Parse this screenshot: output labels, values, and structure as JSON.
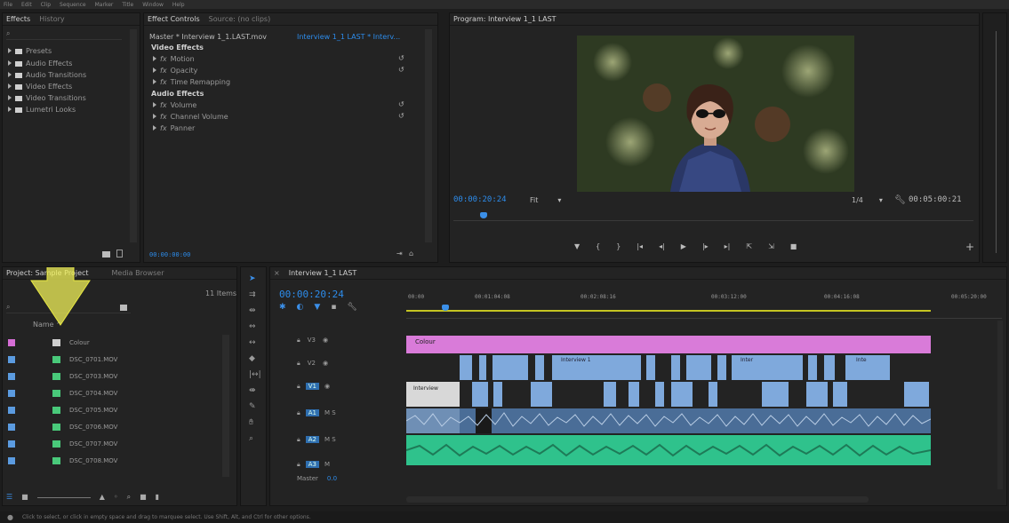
{
  "menubar": [
    "File",
    "Edit",
    "Clip",
    "Sequence",
    "Marker",
    "Title",
    "Window",
    "Help"
  ],
  "effects_panel": {
    "tabs": [
      "Effects",
      "History"
    ],
    "items": [
      "Presets",
      "Audio Effects",
      "Audio Transitions",
      "Video Effects",
      "Video Transitions",
      "Lumetri Looks"
    ]
  },
  "effect_controls": {
    "tabs": [
      "Effect Controls",
      "Source: (no clips)"
    ],
    "master_label": "Master * Interview 1_1.LAST.mov",
    "sequence_label": "Interview 1_1 LAST * Interv...",
    "video_header": "Video Effects",
    "video_items": [
      "Motion",
      "Opacity",
      "Time Remapping"
    ],
    "audio_header": "Audio Effects",
    "audio_items": [
      "Volume",
      "Channel Volume",
      "Panner"
    ],
    "timecode": "00:00:00:00"
  },
  "program_monitor": {
    "title": "Program: Interview 1_1 LAST",
    "timecode": "00:00:20:24",
    "fit_label": "Fit",
    "quality_label": "1/4",
    "duration": "00:05:00:21"
  },
  "project_panel": {
    "tabs": [
      "Project: Sample Project",
      "Media Browser"
    ],
    "items_count": "11 Items",
    "name_header": "Name",
    "items": [
      {
        "name": "Colour",
        "color": "#d66ed6"
      },
      {
        "name": "DSC_0701.MOV",
        "color": "#5b9be0"
      },
      {
        "name": "DSC_0703.MOV",
        "color": "#5b9be0"
      },
      {
        "name": "DSC_0704.MOV",
        "color": "#5b9be0"
      },
      {
        "name": "DSC_0705.MOV",
        "color": "#5b9be0"
      },
      {
        "name": "DSC_0706.MOV",
        "color": "#5b9be0"
      },
      {
        "name": "DSC_0707.MOV",
        "color": "#5b9be0"
      },
      {
        "name": "DSC_0708.MOV",
        "color": "#5b9be0"
      }
    ]
  },
  "timeline": {
    "tab": "Interview 1_1 LAST",
    "timecode": "00:00:20:24",
    "ruler": [
      "00:00",
      "00:01:04:08",
      "00:02:08:16",
      "00:03:12:00",
      "00:04:16:08",
      "00:05:20:00"
    ],
    "tracks": [
      "V3",
      "V2",
      "V1",
      "A1",
      "A2",
      "A3"
    ],
    "master_label": "Master",
    "master_value": "0.0",
    "clip_labels": {
      "colour": "Colour",
      "interview_v2": "Interview 1",
      "inter_v2": "Inter",
      "int_v2": "Inte",
      "interview_v1": "Interview"
    }
  },
  "status_bar": "Click to select, or click in empty space and drag to marquee select. Use Shift, Alt, and Ctrl for other options."
}
